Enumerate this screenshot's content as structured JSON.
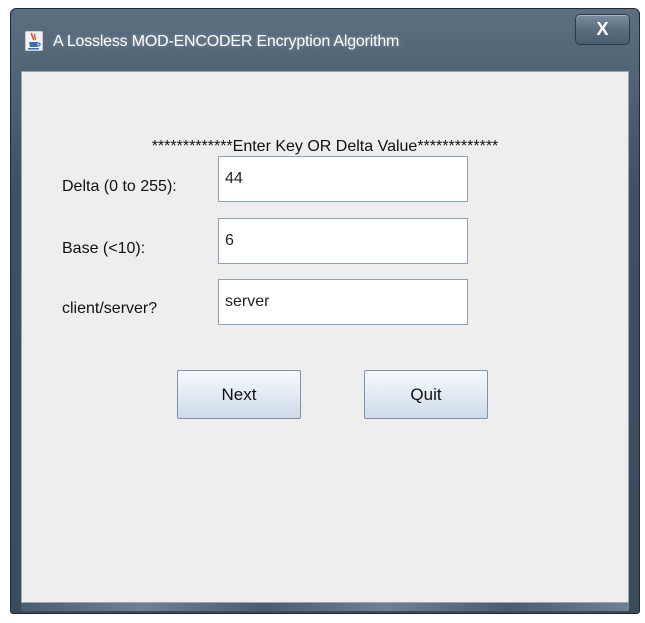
{
  "window": {
    "title": "A Lossless MOD-ENCODER Encryption Algorithm",
    "close_label": "X"
  },
  "form": {
    "heading": "*************Enter Key OR Delta Value*************",
    "fields": [
      {
        "label": "Delta (0 to 255):",
        "value": "44"
      },
      {
        "label": "Base (<10):",
        "value": "6"
      },
      {
        "label": "client/server?",
        "value": "server"
      }
    ]
  },
  "buttons": {
    "next_label": "Next",
    "quit_label": "Quit"
  },
  "icons": {
    "app": "java-cup-icon",
    "close": "close-icon"
  },
  "colors": {
    "titlebar": "#3e5163",
    "client_background": "#eeeeee",
    "button_gradient_top": "#f7f9fc",
    "button_gradient_bottom": "#cfdbe8"
  }
}
